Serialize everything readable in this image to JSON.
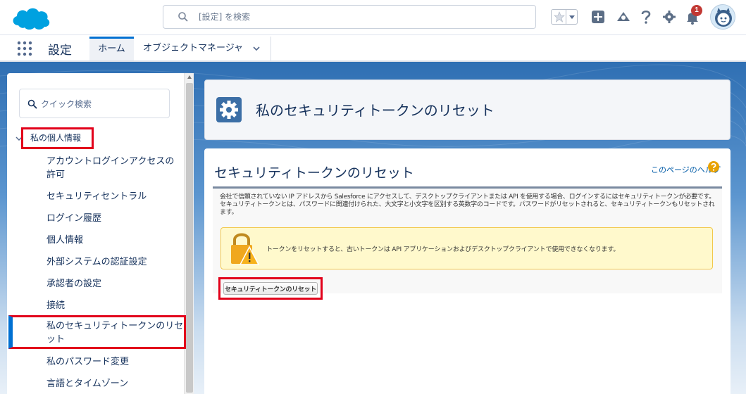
{
  "header": {
    "search_placeholder": "[設定] を検索",
    "notification_count": "1"
  },
  "nav": {
    "app_name": "設定",
    "tabs": [
      {
        "label": "ホーム"
      },
      {
        "label": "オブジェクトマネージャ"
      }
    ]
  },
  "sidebar": {
    "quick_search_placeholder": "クイック検索",
    "section_title": "私の個人情報",
    "items": [
      {
        "label": "アカウントログインアクセスの許可"
      },
      {
        "label": "セキュリティセントラル"
      },
      {
        "label": "ログイン履歴"
      },
      {
        "label": "個人情報"
      },
      {
        "label": "外部システムの認証設定"
      },
      {
        "label": "承認者の設定"
      },
      {
        "label": "接続"
      },
      {
        "label": "私のセキュリティトークンのリセット"
      },
      {
        "label": "私のパスワード変更"
      },
      {
        "label": "言語とタイムゾーン"
      }
    ]
  },
  "page": {
    "title": "私のセキュリティトークンのリセット",
    "content_title": "セキュリティトークンのリセット",
    "help_link": "このページのヘルプ",
    "description": "会社で信頼されていない IP アドレスから Salesforce にアクセスして、デスクトップクライアントまたは API を使用する場合、ログインするにはセキュリティトークンが必要です。セキュリティトークンとは、パスワードに関連付けられた、大文字と小文字を区別する英数字のコードです。パスワードがリセットされると、セキュリティトークンもリセットされます。",
    "warning": "トークンをリセットすると、古いトークンは API アプリケーションおよびデスクトップクライアントで使用できなくなります。",
    "reset_button": "セキュリティトークンのリセット"
  },
  "colors": {
    "brand_blue": "#00a1e0",
    "highlight_red": "#e2001a",
    "active_blue": "#0070d2"
  }
}
